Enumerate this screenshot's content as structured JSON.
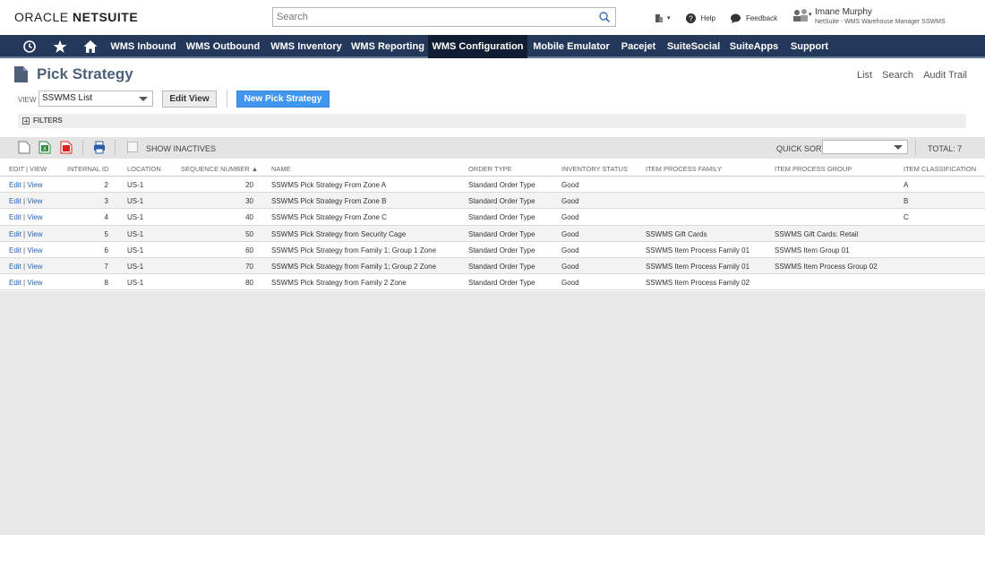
{
  "header": {
    "logo_oracle": "ORACLE",
    "logo_netsuite": "NETSUITE",
    "search_placeholder": "Search",
    "help": "Help",
    "feedback": "Feedback",
    "user_name": "Imane Murphy",
    "user_role": "NetSuite - WMS Warehouse Manager SSWMS"
  },
  "nav": {
    "items": [
      "WMS Inbound",
      "WMS Outbound",
      "WMS Inventory",
      "WMS Reporting",
      "WMS Configuration",
      "Mobile Emulator",
      "Pacejet",
      "SuiteSocial",
      "SuiteApps",
      "Support"
    ],
    "active": "WMS Configuration"
  },
  "page": {
    "title": "Pick Strategy",
    "links": [
      "List",
      "Search",
      "Audit Trail"
    ],
    "view_label": "VIEW",
    "view_value": "SSWMS List",
    "edit_view": "Edit View",
    "new_button": "New Pick Strategy",
    "filters": "FILTERS"
  },
  "toolbar": {
    "show_inactives": "SHOW INACTIVES",
    "quick_sort": "QUICK SORT",
    "total": "TOTAL: 7"
  },
  "table": {
    "columns": [
      "EDIT | VIEW",
      "INTERNAL ID",
      "LOCATION",
      "SEQUENCE NUMBER ▲",
      "NAME",
      "ORDER TYPE",
      "INVENTORY STATUS",
      "ITEM PROCESS FAMILY",
      "ITEM PROCESS GROUP",
      "ITEM CLASSIFICATION"
    ],
    "edit": "Edit",
    "view": "View",
    "rows": [
      {
        "id": "2",
        "location": "US-1",
        "seq": "20",
        "name": "SSWMS Pick Strategy From Zone A",
        "order_type": "Standard Order Type",
        "status": "Good",
        "family": "",
        "group": "",
        "class": "A"
      },
      {
        "id": "3",
        "location": "US-1",
        "seq": "30",
        "name": "SSWMS Pick Strategy From Zone B",
        "order_type": "Standard Order Type",
        "status": "Good",
        "family": "",
        "group": "",
        "class": "B"
      },
      {
        "id": "4",
        "location": "US-1",
        "seq": "40",
        "name": "SSWMS Pick Strategy From Zone C",
        "order_type": "Standard Order Type",
        "status": "Good",
        "family": "",
        "group": "",
        "class": "C"
      },
      {
        "id": "5",
        "location": "US-1",
        "seq": "50",
        "name": "SSWMS Pick Strategy from Security Cage",
        "order_type": "Standard Order Type",
        "status": "Good",
        "family": "SSWMS Gift Cards",
        "group": "SSWMS Gift Cards: Retail",
        "class": ""
      },
      {
        "id": "6",
        "location": "US-1",
        "seq": "60",
        "name": "SSWMS Pick Strategy from Family 1; Group 1 Zone",
        "order_type": "Standard Order Type",
        "status": "Good",
        "family": "SSWMS Item Process Family 01",
        "group": "SSWMS Item Group 01",
        "class": ""
      },
      {
        "id": "7",
        "location": "US-1",
        "seq": "70",
        "name": "SSWMS Pick Strategy from Family 1; Group 2 Zone",
        "order_type": "Standard Order Type",
        "status": "Good",
        "family": "SSWMS Item Process Family 01",
        "group": "SSWMS Item Process Group 02",
        "class": ""
      },
      {
        "id": "8",
        "location": "US-1",
        "seq": "80",
        "name": "SSWMS Pick Strategy from Family 2 Zone",
        "order_type": "Standard Order Type",
        "status": "Good",
        "family": "SSWMS Item Process Family 02",
        "group": "",
        "class": ""
      }
    ]
  }
}
